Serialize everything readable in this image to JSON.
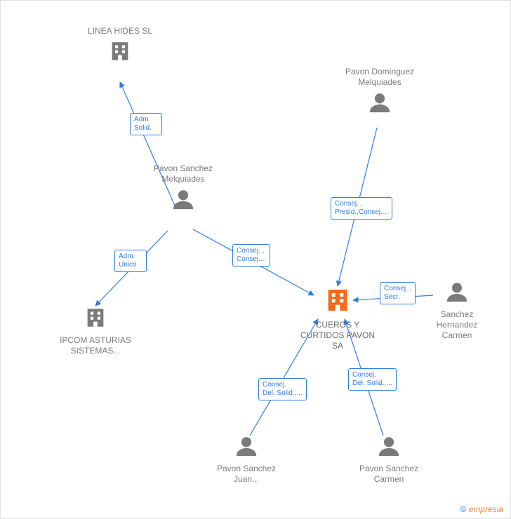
{
  "colors": {
    "line": "#2f7de1",
    "label_border": "#2f7de1",
    "label_text": "#2f7de1",
    "node_text": "#7a7a7a",
    "person_icon": "#7a7a7a",
    "company_icon": "#7a7a7a",
    "focus_icon": "#f26a1b"
  },
  "nodes": {
    "linea_hides": {
      "type": "company",
      "label": "LINEA\nHIDES SL"
    },
    "pavon_sanchez_melquiades": {
      "type": "person",
      "label": "Pavon\nSanchez\nMelquiades"
    },
    "pavon_dominguez_melquiades": {
      "type": "person",
      "label": "Pavon\nDominguez\nMelquiades"
    },
    "ipcom": {
      "type": "company",
      "label": "IPCOM\nASTURIAS\nSISTEMAS..."
    },
    "cueros": {
      "type": "company_focus",
      "label": "CUEROS Y\nCURTIDOS\nPAVON SA"
    },
    "sanchez_hernandez_carmen": {
      "type": "person",
      "label": "Sanchez\nHernandez\nCarmen"
    },
    "pavon_sanchez_juan": {
      "type": "person",
      "label": "Pavon\nSanchez\nJuan..."
    },
    "pavon_sanchez_carmen": {
      "type": "person",
      "label": "Pavon\nSanchez\nCarmen"
    }
  },
  "edges": {
    "e1": {
      "label": "Adm.\nSolid."
    },
    "e2": {
      "label": "Adm.\nUnico"
    },
    "e3": {
      "label": "Consej. ,\nConsej...."
    },
    "e4": {
      "label": "Consej. ,\nPresid.,Consej...."
    },
    "e5": {
      "label": "Consej. ,\nSecr."
    },
    "e6": {
      "label": "Consej.\nDel. Solid.,..."
    },
    "e7": {
      "label": "Consej.\nDel. Solid.,..."
    }
  },
  "footer": {
    "copyright_symbol": "©",
    "brand": "empresia"
  }
}
